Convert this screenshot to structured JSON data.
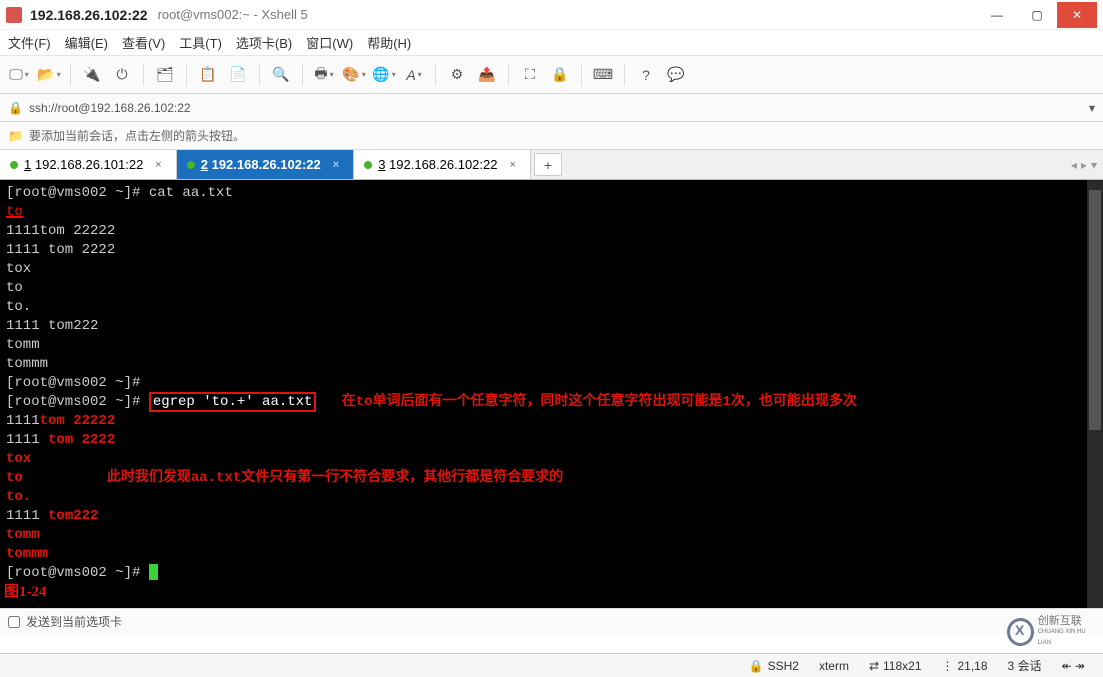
{
  "window": {
    "title_main": "192.168.26.102:22",
    "title_sub": "root@vms002:~ - Xshell 5"
  },
  "menu": {
    "file": "文件(F)",
    "edit": "编辑(E)",
    "view": "查看(V)",
    "tools": "工具(T)",
    "tabs": "选项卡(B)",
    "window": "窗口(W)",
    "help": "帮助(H)"
  },
  "address": {
    "url": "ssh://root@192.168.26.102:22"
  },
  "hintbar": {
    "icon": "📁",
    "text": "要添加当前会话，点击左侧的箭头按钮。"
  },
  "tabs": [
    {
      "num": "1",
      "label": "192.168.26.101:22",
      "active": false
    },
    {
      "num": "2",
      "label": "192.168.26.102:22",
      "active": true
    },
    {
      "num": "3",
      "label": "192.168.26.102:22",
      "active": false
    }
  ],
  "terminal": {
    "prompt": "[root@vms002 ~]# ",
    "cmd1": "cat aa.txt",
    "out": {
      "l1": "to",
      "l2": "1111tom 22222",
      "l3": "1111 tom 2222",
      "l4": "tox",
      "l5": "to",
      "l6": "to.",
      "l7": "1111 tom222",
      "l8": "tomm",
      "l9": "tommm"
    },
    "cmd2_box": "egrep 'to.+' aa.txt",
    "ann1": "在to单词后面有一个任意字符，同时这个任意字符出现可能是1次，也可能出现多次",
    "g": {
      "l1_pre": "1111",
      "l1_match": "tom 22222",
      "l2_pre": "1111 ",
      "l2_match": "tom 2222",
      "l3_match": "tox",
      "l4_pre_match": "to",
      "l5_match": "to.",
      "l6_pre": "1111 ",
      "l6_match": "tom222",
      "l7_match": "tomm",
      "l8_match": "tommm"
    },
    "ann2": "此时我们发现aa.txt文件只有第一行不符合要求，其他行都是符合要求的",
    "fig": "图1-24"
  },
  "footer": {
    "text": "发送到当前选项卡"
  },
  "status": {
    "ssh": "SSH2",
    "term": "xterm",
    "size": "118x21",
    "pos": "21,18",
    "sess": "3 会话",
    "arrows": "↞ ↠"
  },
  "logo": {
    "line1": "创新互联",
    "line2": "CHUANG XIN HU LIAN"
  }
}
